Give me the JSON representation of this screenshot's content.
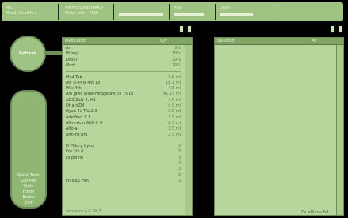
{
  "header": {
    "cell1_line1": "Mo...",
    "cell1_line2": "Mood:",
    "cell1_value": "Pe-aFfe-t.",
    "cell2_line1": "Ammo Sure:",
    "cell2_line2": "Mood Life:",
    "cell2_value1": "Fre#Cy",
    "cell2_value2": "71th",
    "cell3_label": "",
    "cell4_label": "Avg:",
    "cell5_label": "Days:"
  },
  "left": {
    "top_button_label": "Refresh",
    "menu": [
      "",
      "",
      "",
      "",
      "",
      "",
      "",
      "",
      "",
      "",
      "Quick Tools",
      "Log Mix",
      "Stats",
      "Home",
      "Books",
      "Exit"
    ]
  },
  "left_panel": {
    "title": "Medication",
    "col2": "Qty",
    "rows": [
      {
        "name": "Ari",
        "value": "3%"
      },
      {
        "name": "Pillary",
        "value": "19%"
      },
      {
        "name": "Dosal",
        "value": "29%"
      },
      {
        "name": "Mort",
        "value": "29%"
      },
      {
        "name": "",
        "value": ""
      },
      {
        "name": "Med Tab",
        "value": "1.5 ml"
      },
      {
        "name": "Aft TT-Pills 4th 18",
        "value": "18.1 ml"
      },
      {
        "name": "Pills 4th",
        "value": "4.5 ml"
      },
      {
        "name": "Am Jaws Wine-Hedgeraw Ee 75 Di",
        "value": "41.15 ml"
      },
      {
        "name": "ADZ ZaQ 4,-H1",
        "value": "4.5 ml"
      },
      {
        "name": "Ot a-nZM",
        "value": "4.5 ml"
      },
      {
        "name": "Hyau 4x-Tfa 2.3",
        "value": "9.9 ml"
      },
      {
        "name": "Adelfiurt 1.1",
        "value": "1.5 ml"
      },
      {
        "name": "AMnl-Arm ABC-U 6",
        "value": "2.5 ml"
      },
      {
        "name": "Alfo-a",
        "value": "1.5 ml"
      },
      {
        "name": "Ahn-Fit Bfu",
        "value": "2.5 ml"
      },
      {
        "name": "",
        "value": ""
      },
      {
        "name": "Pl Pillory Cyco",
        "value": "3"
      },
      {
        "name": "Fm 7th 0",
        "value": "3"
      },
      {
        "name": "Ls pill h0",
        "value": "3"
      },
      {
        "name": "",
        "value": "3"
      },
      {
        "name": "",
        "value": "3"
      },
      {
        "name": "",
        "value": "3"
      },
      {
        "name": "Fn s/EZ Hm",
        "value": "3"
      }
    ],
    "footer": "Acocatra 4.0 7h 7"
  },
  "right_panel": {
    "title": "Selection",
    "col2": "Ab"
  },
  "bottom_caption": "Pb wI3 mc Fat"
}
